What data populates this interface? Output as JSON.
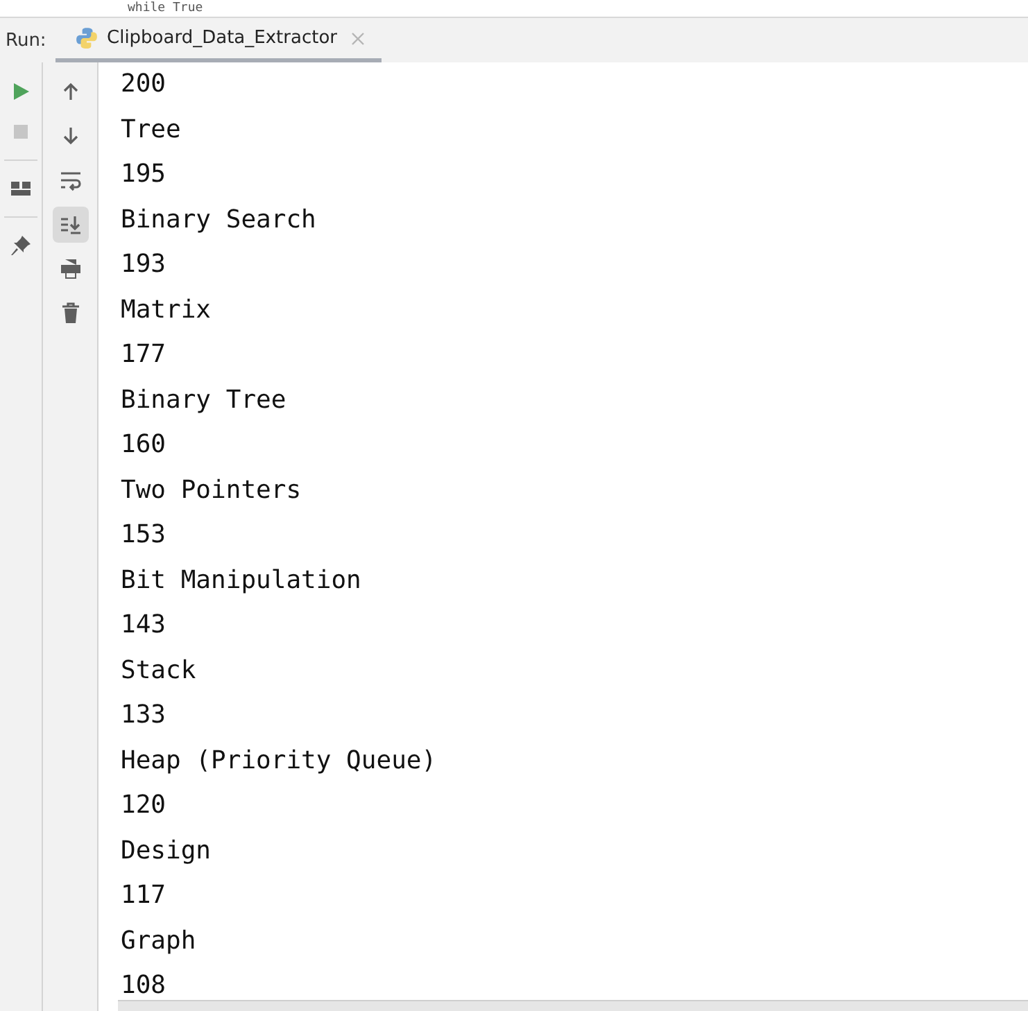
{
  "editor_line": "while True",
  "run_bar": {
    "label": "Run:",
    "tab": {
      "title": "Clipboard_Data_Extractor",
      "selected": true
    }
  },
  "left_toolbar": [
    {
      "kind": "run",
      "disabled": false
    },
    {
      "kind": "stop",
      "disabled": true
    },
    {
      "kind": "layout",
      "disabled": false
    },
    {
      "kind": "pin",
      "disabled": false
    }
  ],
  "console_toolbar": [
    {
      "kind": "up",
      "on": false
    },
    {
      "kind": "down",
      "on": false
    },
    {
      "kind": "wrap",
      "on": false
    },
    {
      "kind": "scroll-end",
      "on": true
    },
    {
      "kind": "print",
      "on": false
    },
    {
      "kind": "trash",
      "on": false
    }
  ],
  "output_lines": [
    "200",
    "Tree",
    "195",
    "Binary Search",
    "193",
    "Matrix",
    "177",
    "Binary Tree",
    "160",
    "Two Pointers",
    "153",
    "Bit Manipulation",
    "143",
    "Stack",
    "133",
    "Heap (Priority Queue)",
    "120",
    "Design",
    "117",
    "Graph",
    "108"
  ]
}
